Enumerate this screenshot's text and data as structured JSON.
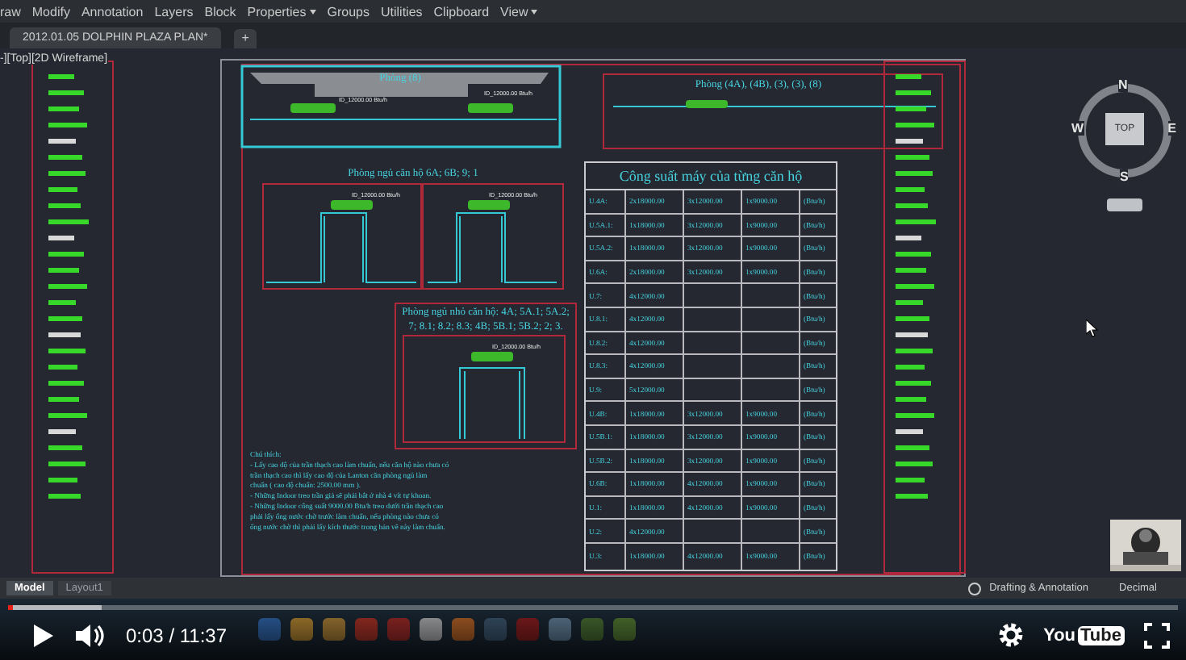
{
  "menu": [
    "raw",
    "Modify",
    "Annotation",
    "Layers",
    "Block",
    "Properties",
    "Groups",
    "Utilities",
    "Clipboard",
    "View"
  ],
  "document_tab": {
    "title": "2012.01.05 DOLPHIN PLAZA PLAN*",
    "new_tab": "+"
  },
  "viewport_label": "-][Top][2D Wireframe]",
  "drawing_titles": [
    "Phòng (8)",
    "Phòng (4A), (4B), (3), (3), (8)",
    "Phòng ngủ căn hộ 6A; 6B; 9; 1",
    "Phòng ngủ nhỏ căn hộ: 4A; 5A.1; 5A.2;",
    "7; 8.1; 8.2; 8.3; 4B; 5B.1; 5B.2; 2; 3."
  ],
  "unit_labels": [
    "ID_12000.00 Btu/h",
    "ID_12000.00 Btu/h",
    "ID_12000.00 Btu/h",
    "ID_12000.00 Btu/h",
    "ID_12000.00 Btu/h"
  ],
  "notes": [
    "Chú thích:",
    "- Lấy cao độ của trần thạch cao làm chuẩn, nếu căn hộ nào chưa có",
    "trần thạch cao thì lấy cao độ của Lanton căn phòng ngủ làm",
    "chuẩn ( cao độ chuẩn: 2500.00 mm ).",
    "- Những Indoor treo trần giả sẽ phải bắt ở nhà 4 vít tự khoan.",
    "- Những Indoor công suất 9000.00 Btu/h treo dưới trần thạch cao",
    "phải lấy ống nước chờ trước làm chuẩn, nếu phòng nào chưa có",
    "ống nước chờ thì phải lấy kích thước trong bản vẽ này làm chuẩn."
  ],
  "capacity_table": {
    "title": "Công suất máy của từng căn hộ",
    "rows": [
      {
        "cells": [
          "U.4A:",
          "2x18000.00",
          "3x12000.00",
          "1x9000.00",
          "(Btu/h)"
        ]
      },
      {
        "cells": [
          "U.5A.1:",
          "1x18000.00",
          "3x12000.00",
          "1x9000.00",
          "(Btu/h)"
        ]
      },
      {
        "cells": [
          "U.5A.2:",
          "1x18000.00",
          "3x12000.00",
          "1x9000.00",
          "(Btu/h)"
        ]
      },
      {
        "cells": [
          "U.6A:",
          "2x18000.00",
          "3x12000.00",
          "1x9000.00",
          "(Btu/h)"
        ]
      },
      {
        "cells": [
          "U.7:",
          "4x12000.00",
          "",
          "",
          "(Btu/h)"
        ]
      },
      {
        "cells": [
          "U.8.1:",
          "4x12000.00",
          "",
          "",
          "(Btu/h)"
        ]
      },
      {
        "cells": [
          "U.8.2:",
          "4x12000.00",
          "",
          "",
          "(Btu/h)"
        ]
      },
      {
        "cells": [
          "U.8.3:",
          "4x12000.00",
          "",
          "",
          "(Btu/h)"
        ]
      },
      {
        "cells": [
          "U.9:",
          "5x12000.00",
          "",
          "",
          "(Btu/h)"
        ]
      },
      {
        "cells": [
          "U.4B:",
          "1x18000.00",
          "3x12000.00",
          "1x9000.00",
          "(Btu/h)"
        ]
      },
      {
        "cells": [
          "U.5B.1:",
          "1x18000.00",
          "3x12000.00",
          "1x9000.00",
          "(Btu/h)"
        ]
      },
      {
        "cells": [
          "U.5B.2:",
          "1x18000.00",
          "3x12000.00",
          "1x9000.00",
          "(Btu/h)"
        ]
      },
      {
        "cells": [
          "U.6B:",
          "1x18000.00",
          "4x12000.00",
          "1x9000.00",
          "(Btu/h)"
        ]
      },
      {
        "cells": [
          "U.1:",
          "1x18000.00",
          "4x12000.00",
          "1x9000.00",
          "(Btu/h)"
        ]
      },
      {
        "cells": [
          "U.2:",
          "4x12000.00",
          "",
          "",
          "(Btu/h)"
        ]
      },
      {
        "cells": [
          "U.3:",
          "1x18000.00",
          "4x12000.00",
          "1x9000.00",
          "(Btu/h)"
        ]
      }
    ]
  },
  "viewcube": {
    "north": "N",
    "west": "W",
    "east": "E",
    "south": "S",
    "face": "TOP"
  },
  "layout_tabs": [
    {
      "label": "Model",
      "selected": true
    },
    {
      "label": "Layout1",
      "selected": false
    }
  ],
  "status_bar": {
    "workspace": "Drafting & Annotation",
    "units": "Decimal"
  },
  "player": {
    "time": "0:03 / 11:37",
    "level": 0.004,
    "logo_you": "You",
    "logo_tube": "Tube"
  }
}
